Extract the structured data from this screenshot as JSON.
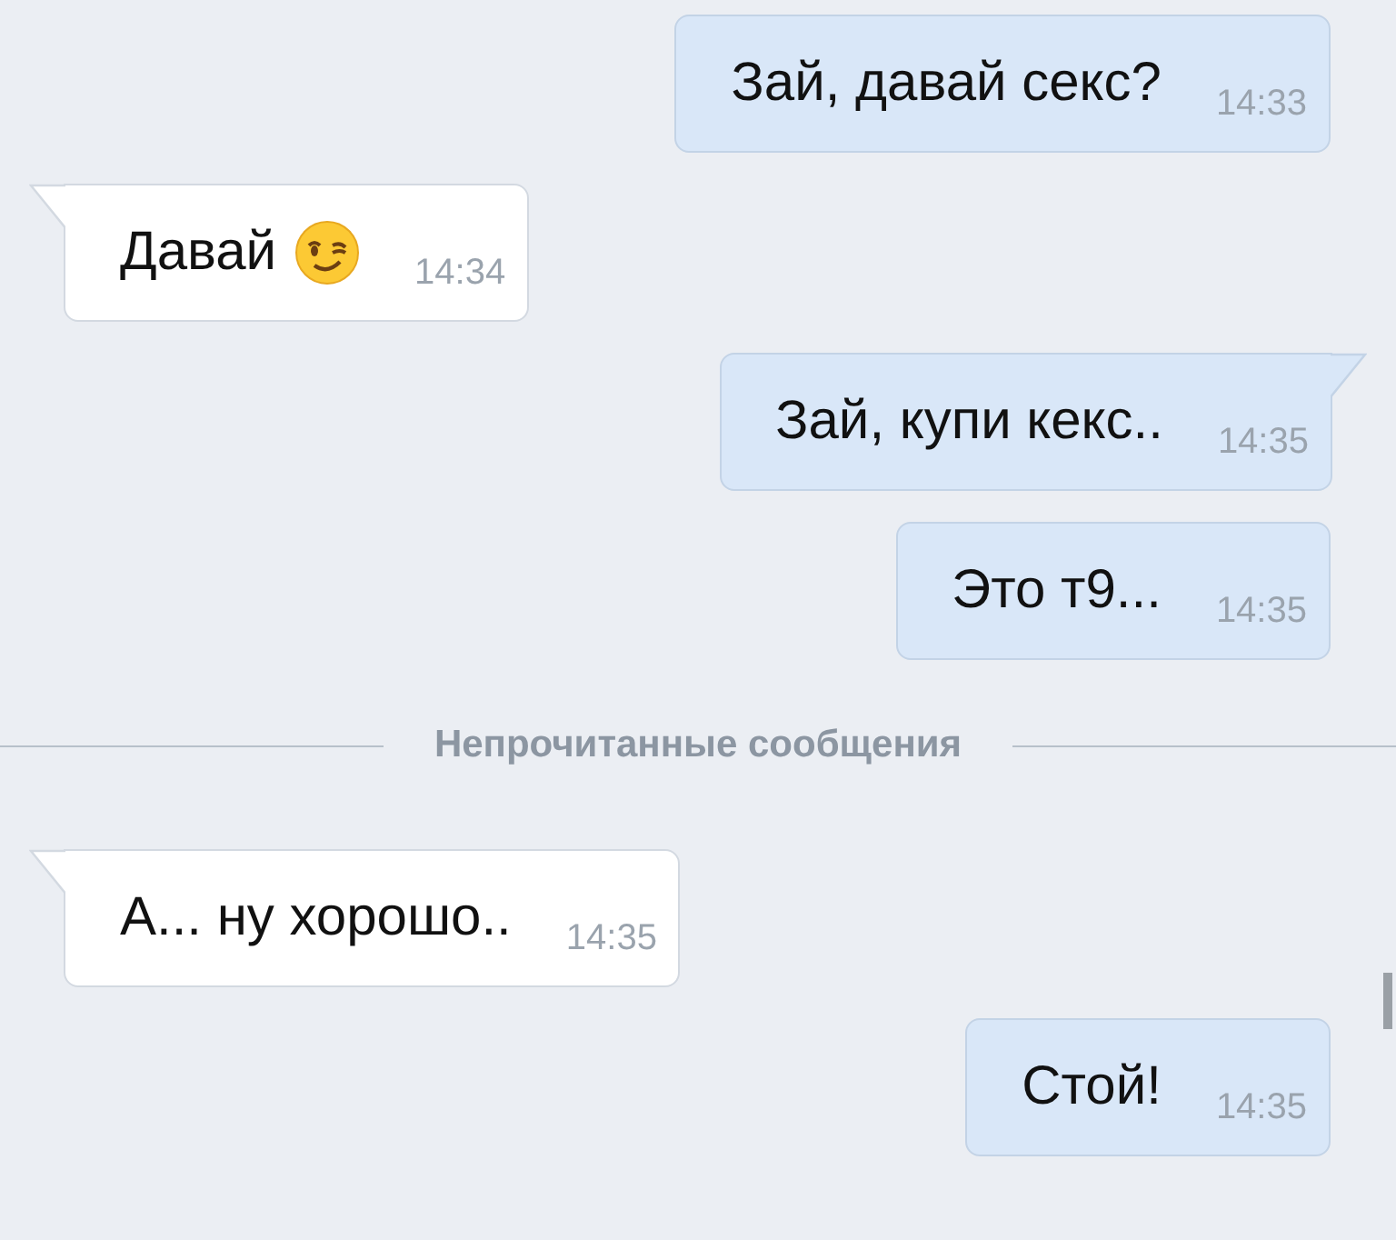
{
  "messages": [
    {
      "kind": "outgoing",
      "text": "Зай, давай секс?",
      "time": "14:33",
      "tail": false
    },
    {
      "kind": "incoming",
      "text": "Давай",
      "emoji": true,
      "time": "14:34",
      "tail": true
    },
    {
      "kind": "outgoing",
      "text": "Зай, купи кекс..",
      "time": "14:35",
      "tail": true
    },
    {
      "kind": "outgoing",
      "text": "Это т9...",
      "time": "14:35",
      "tail": false
    },
    {
      "kind": "divider",
      "text": "Непрочитанные сообщения"
    },
    {
      "kind": "incoming",
      "text": "А... ну хорошо..",
      "time": "14:35",
      "tail": true
    },
    {
      "kind": "outgoing",
      "text": "Стой!",
      "time": "14:35",
      "tail": false
    }
  ]
}
